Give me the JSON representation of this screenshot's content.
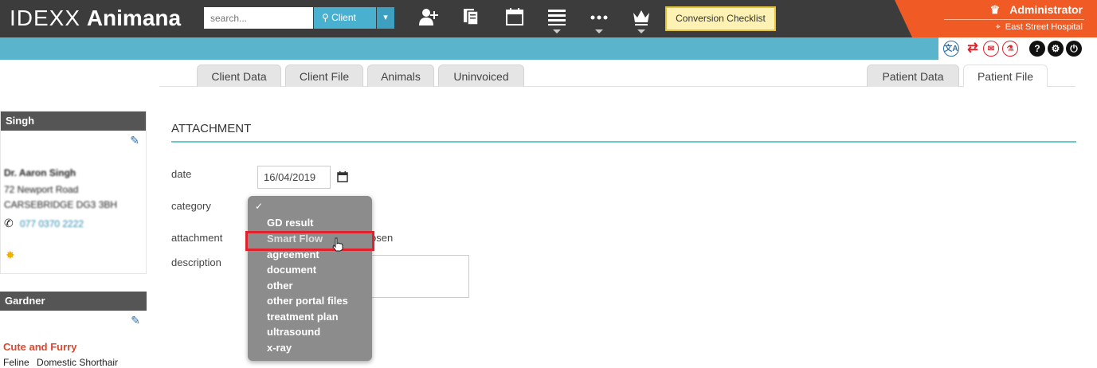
{
  "brand": {
    "light": "IDEXX",
    "bold": "Animana"
  },
  "search": {
    "placeholder": "search...",
    "scope_label": "Client"
  },
  "toolbar": {
    "icons": [
      "add-client-icon",
      "documents-icon",
      "calendar-icon",
      "list-icon",
      "more-icon",
      "crown-icon"
    ],
    "conversion_label": "Conversion Checklist"
  },
  "user": {
    "name": "Administrator",
    "location": "East Street Hospital"
  },
  "tabs_left": [
    "Client Data",
    "Client File",
    "Animals",
    "Uninvoiced"
  ],
  "tabs_right": [
    "Patient Data",
    "Patient File"
  ],
  "active_tab": "Patient File",
  "client_card": {
    "title": "Singh",
    "name": "Dr. Aaron Singh",
    "address1": "72 Newport Road",
    "address2": "CARSEBRIDGE DG3 3BH",
    "phone": "077 0370 2222"
  },
  "patient_card": {
    "title": "Gardner",
    "alert": "Cute and Furry",
    "species": "Feline",
    "breed": "Domestic Shorthair"
  },
  "form": {
    "section_title": "ATTACHMENT",
    "date_label": "date",
    "date_value": "16/04/2019",
    "category_label": "category",
    "attachment_label": "attachment",
    "attachment_status_fragment": "osen",
    "description_label": "description"
  },
  "category_dropdown": {
    "options": [
      "",
      "GD result",
      "Smart Flow",
      "agreement",
      "document",
      "other",
      "other portal files",
      "treatment plan",
      "ultrasound",
      "x-ray"
    ],
    "selected_index": 0,
    "hovered_index": 2
  },
  "colors": {
    "accent_orange": "#f05a24",
    "accent_blue": "#5ab5cc",
    "highlight_red": "#e0222c"
  }
}
